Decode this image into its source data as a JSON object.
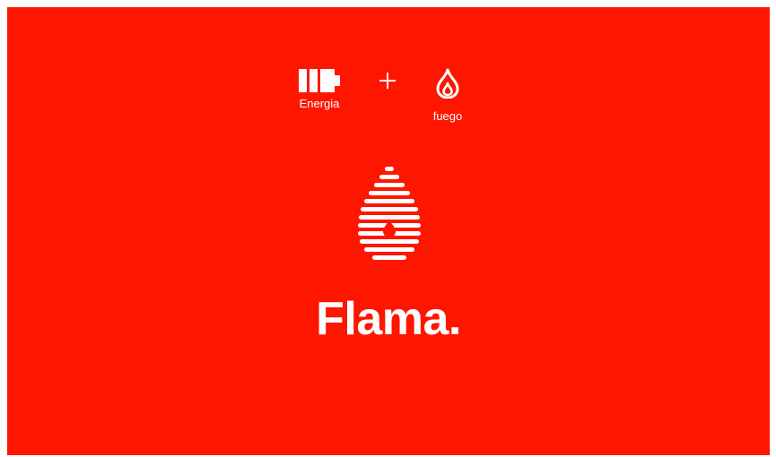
{
  "colors": {
    "background": "#ff1600",
    "foreground": "#ffffff"
  },
  "concept": {
    "left": {
      "icon": "battery-icon",
      "label": "Energia"
    },
    "operator_icon": "plus-icon",
    "right": {
      "icon": "flame-icon",
      "label": "fuego"
    }
  },
  "logo": {
    "icon": "striped-drop-icon",
    "wordmark": "Flama."
  }
}
